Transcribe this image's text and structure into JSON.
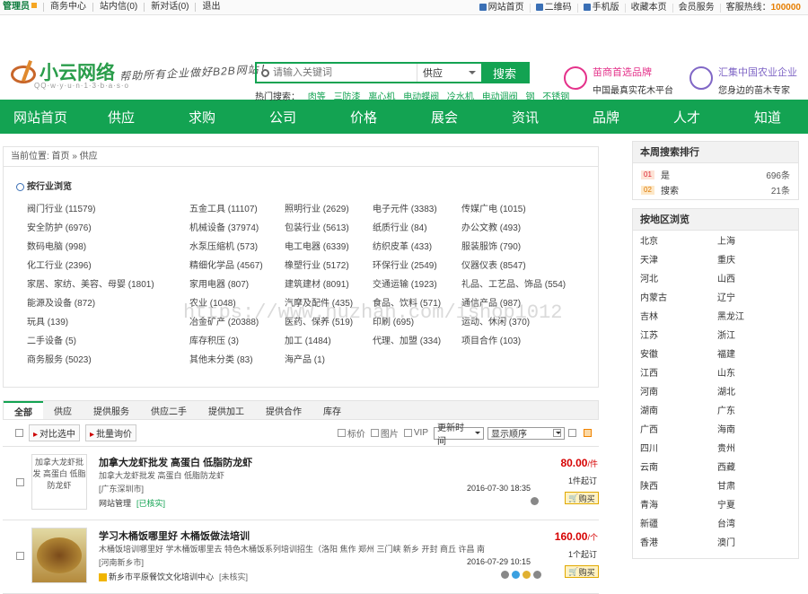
{
  "topbar": {
    "left": [
      "管理员",
      "商务中心",
      "站内信(0)",
      "新对话(0)",
      "退出"
    ],
    "right": {
      "home": "网站首页",
      "qrcode": "二维码",
      "mobile": "手机版",
      "favorite": "收藏本页",
      "member": "会员服务",
      "hotline_label": "客服热线：",
      "hotline": "100000"
    }
  },
  "logo": {
    "name": "小云网络",
    "sub": "QQ·w·y·u·n·1·3·b·a·s·o",
    "slogan": "帮助所有企业做好B2B网站！"
  },
  "search": {
    "placeholder": "请输入关键词",
    "type": "供应",
    "button": "搜索",
    "hot_label": "热门搜索：",
    "hot": [
      "肉等",
      "三防漆",
      "离心机",
      "电动蝶阀",
      "冷水机",
      "电动调阀",
      "钢",
      "不锈钢"
    ]
  },
  "promos": [
    {
      "title": "苗商首选品牌",
      "sub": "中国最真实花木平台",
      "color": "#e4318a"
    },
    {
      "title": "汇集中国农业企业",
      "sub": "您身边的苗木专家",
      "color": "#8067c6"
    }
  ],
  "nav": [
    "网站首页",
    "供应",
    "求购",
    "公司",
    "价格",
    "展会",
    "资讯",
    "品牌",
    "人才",
    "知道"
  ],
  "breadcrumb": "当前位置: 首页 » 供应",
  "categories": {
    "title": "按行业浏览",
    "rows": [
      [
        "阀门行业 (11579)",
        "五金工具 (11107)",
        "照明行业 (2629)",
        "电子元件 (3383)",
        "传媒广电 (1015)"
      ],
      [
        "安全防护 (6976)",
        "机械设备 (37974)",
        "包装行业 (5613)",
        "纸质行业 (84)",
        "办公文教 (493)"
      ],
      [
        "数码电脑 (998)",
        "水泵压缩机 (573)",
        "电工电器 (6339)",
        "纺织皮革 (433)",
        "服装服饰 (790)"
      ],
      [
        "化工行业 (2396)",
        "精细化学品 (4567)",
        "橡塑行业 (5172)",
        "环保行业 (2549)",
        "仪器仪表 (8547)"
      ],
      [
        "家居、家纺、美容、母婴 (1801)",
        "家用电器 (807)",
        "建筑建材 (8091)",
        "交通运输 (1923)",
        "礼品、工艺品、饰品 (554)"
      ],
      [
        "能源及设备 (872)",
        "农业 (1048)",
        "汽摩及配件 (435)",
        "食品、饮料 (571)",
        "通信产品 (987)"
      ],
      [
        "玩具 (139)",
        "冶金矿产 (20388)",
        "医药、保养 (519)",
        "印刷 (695)",
        "运动、休闲 (370)"
      ],
      [
        "二手设备 (5)",
        "库存积压 (3)",
        "加工 (1484)",
        "代理、加盟 (334)",
        "项目合作 (103)"
      ],
      [
        "商务服务 (5023)",
        "其他未分类 (83)",
        "海产品 (1)",
        "",
        ""
      ]
    ],
    "watermark": "https://www.huzhan.com/ishop1012"
  },
  "tabs": [
    "全部",
    "供应",
    "提供服务",
    "供应二手",
    "提供加工",
    "提供合作",
    "库存"
  ],
  "toolbar": {
    "compare": "对比选中",
    "inquiry": "批量询价",
    "filters": [
      "标价",
      "图片",
      "VIP"
    ],
    "sort": "更新时间",
    "order": "显示顺序"
  },
  "items": [
    {
      "thumb_text": "加拿大龙虾批发 高蛋白 低脂防龙虾",
      "title": "加拿大龙虾批发 高蛋白 低脂防龙虾",
      "desc": "加拿大龙虾批发 高蛋白 低脂防龙虾",
      "location": "[广东深圳市]",
      "company": "网站管理",
      "status": "[已核实]",
      "date": "2016-07-30 18:35",
      "price": "80.00",
      "unit": "/件",
      "moq": "1件起订",
      "buy": "购买"
    },
    {
      "thumb_text": "",
      "title": "学习木桶饭哪里好 木桶饭做法培训",
      "desc": "木桶饭培训哪里好 学木桶饭哪里去 特色木桶饭系列培训招生（洛阳 焦作 郑州 三门峡 新乡 开封 商丘 许昌 南",
      "location": "[河南新乡市]",
      "company": "新乡市平原餐饮文化培训中心",
      "status": "[未核实]",
      "date": "2016-07-29 10:15",
      "price": "160.00",
      "unit": "/个",
      "moq": "1个起订",
      "buy": "购买"
    }
  ],
  "rank": {
    "title": "本周搜索排行",
    "rows": [
      {
        "n": "01",
        "k": "是",
        "v": "696条"
      },
      {
        "n": "02",
        "k": "搜索",
        "v": "21条"
      }
    ]
  },
  "area": {
    "title": "按地区浏览",
    "list": [
      "北京",
      "上海",
      "天津",
      "重庆",
      "河北",
      "山西",
      "内蒙古",
      "辽宁",
      "吉林",
      "黑龙江",
      "江苏",
      "浙江",
      "安徽",
      "福建",
      "江西",
      "山东",
      "河南",
      "湖北",
      "湖南",
      "广东",
      "广西",
      "海南",
      "四川",
      "贵州",
      "云南",
      "西藏",
      "陕西",
      "甘肃",
      "青海",
      "宁夏",
      "新疆",
      "台湾",
      "香港",
      "澳门"
    ]
  }
}
